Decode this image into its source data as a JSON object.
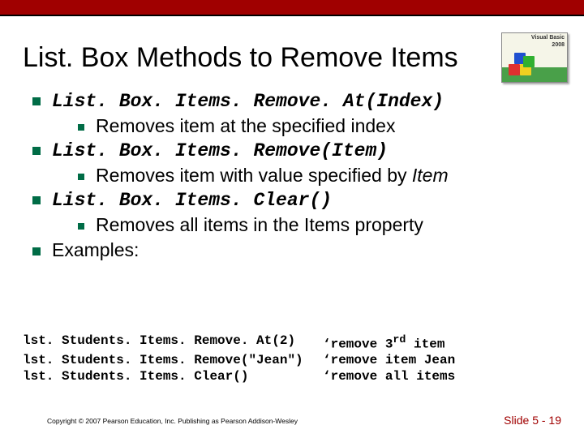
{
  "title": "List. Box Methods to Remove Items",
  "logo": {
    "line1": "Visual Basic",
    "line2": "2008"
  },
  "bullets": {
    "b1": "List. Box. Items. Remove. At(Index)",
    "b1a": "Removes item at the specified index",
    "b2": "List. Box. Items. Remove(Item)",
    "b2a_pre": "Removes item with value specified by ",
    "b2a_em": "Item",
    "b3": "List. Box. Items. Clear()",
    "b3a": "Removes all items in the Items property",
    "b4": "Examples:"
  },
  "examples": [
    {
      "code": "lst. Students. Items. Remove. At(2)",
      "comment": "‘remove 3",
      "sup": "rd",
      "comment2": " item"
    },
    {
      "code": "lst. Students. Items. Remove(\"Jean\")",
      "comment": "‘remove item Jean",
      "sup": "",
      "comment2": ""
    },
    {
      "code": "lst. Students. Items. Clear()",
      "comment": "‘remove all items",
      "sup": "",
      "comment2": ""
    }
  ],
  "footer": {
    "copyright": "Copyright © 2007 Pearson Education, Inc. Publishing as Pearson Addison-Wesley",
    "slide": "Slide 5 - 19"
  }
}
